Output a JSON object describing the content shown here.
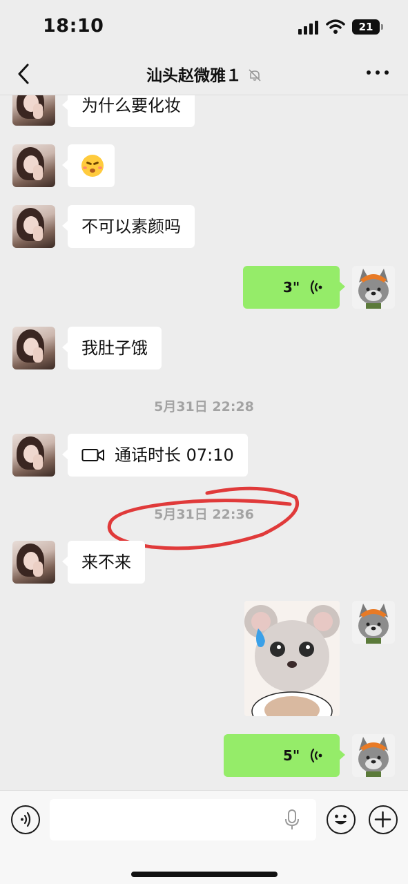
{
  "status_bar": {
    "time": "18:10",
    "battery": "21"
  },
  "nav": {
    "title": "汕头赵微雅１"
  },
  "messages": {
    "m1": "为什么要化妆",
    "m2_emoji": "😚",
    "m3": "不可以素颜吗",
    "voice1_duration": "3\"",
    "m4": "我肚子饿",
    "timestamp1": "5月31日 22:28",
    "call_label": "通话时长 07:10",
    "timestamp2": "5月31日 22:36",
    "m5": "来不来",
    "voice2_duration": "5\""
  },
  "input": {
    "placeholder": "",
    "value": ""
  },
  "colors": {
    "chat_background": "#ededed",
    "incoming_bubble": "#ffffff",
    "outgoing_bubble": "#95ec69",
    "annotation_circle": "#e03a3a"
  },
  "icons": [
    "back-icon",
    "mute-bell-icon",
    "more-icon",
    "voice-wave-icon",
    "video-call-icon",
    "voice-input-icon",
    "microphone-icon",
    "emoji-icon",
    "plus-icon"
  ]
}
